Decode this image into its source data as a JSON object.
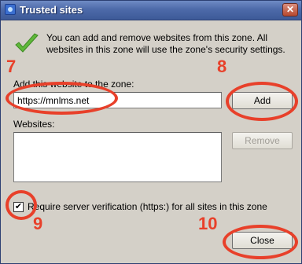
{
  "window": {
    "title": "Trusted sites",
    "close_glyph": "✕"
  },
  "info": {
    "text": "You can add and remove websites from this zone. All websites in this zone will use the zone's security settings."
  },
  "add_section": {
    "label": "Add this website to the zone:",
    "url_value": "https://mnlms.net",
    "add_button": "Add"
  },
  "websites": {
    "label": "Websites:",
    "items": [],
    "remove_button": "Remove"
  },
  "verification": {
    "checked": true,
    "check_glyph": "✔",
    "label": "Require server verification (https:) for all sites in this zone"
  },
  "footer": {
    "close_button": "Close"
  },
  "annotations": {
    "n7": "7",
    "n8": "8",
    "n9": "9",
    "n10": "10"
  },
  "colors": {
    "annotation": "#e8402a",
    "title_bar": "#4d6aa9",
    "dialog_bg": "#d4d0c8"
  }
}
